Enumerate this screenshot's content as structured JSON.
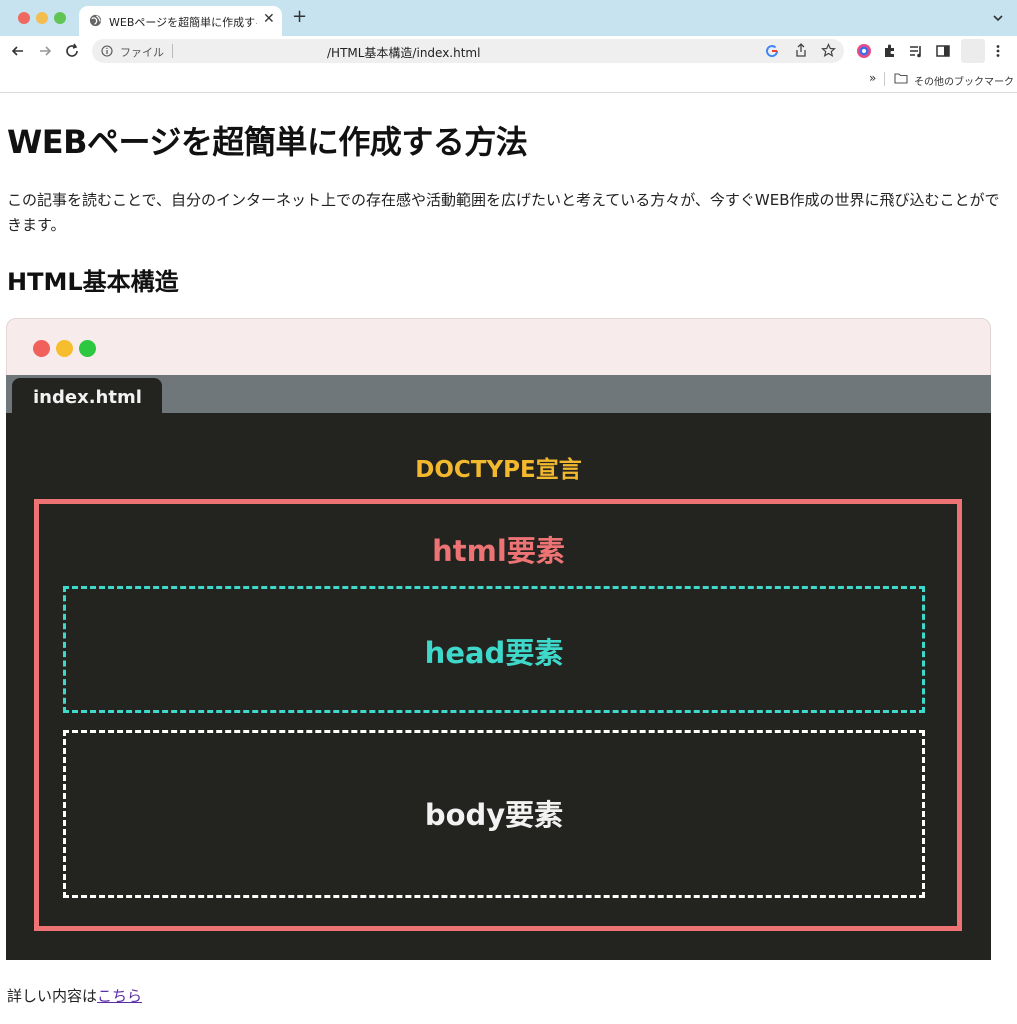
{
  "browser": {
    "tab_title": "WEBページを超簡単に作成する方法",
    "omnibox_file_label": "ファイル",
    "url": "/HTML基本構造/index.html",
    "bookmarks_label": "その他のブックマーク",
    "bookmarks_overflow": "»",
    "new_tab_glyph": "+",
    "close_glyph": "✕"
  },
  "page": {
    "title": "WEBページを超簡単に作成する方法",
    "intro": "この記事を読むことで、自分のインターネット上での存在感や活動範囲を広げたいと考えている方々が、今すぐWEB作成の世界に飛び込むことができます。",
    "section_heading": "HTML基本構造",
    "footer_prefix": "詳しい内容は",
    "footer_link": "こちら"
  },
  "diagram": {
    "file_tab": "index.html",
    "doctype_label": "DOCTYPE宣言",
    "html_label": "html要素",
    "head_label": "head要素",
    "body_label": "body要素"
  },
  "colors": {
    "tabstrip": "#c6e3ef",
    "editor_bg": "#23231f",
    "doctype": "#f2b92f",
    "html": "#ee7374",
    "head": "#3fd9cc",
    "body": "#ffffff",
    "link": "#5a2ea6"
  }
}
